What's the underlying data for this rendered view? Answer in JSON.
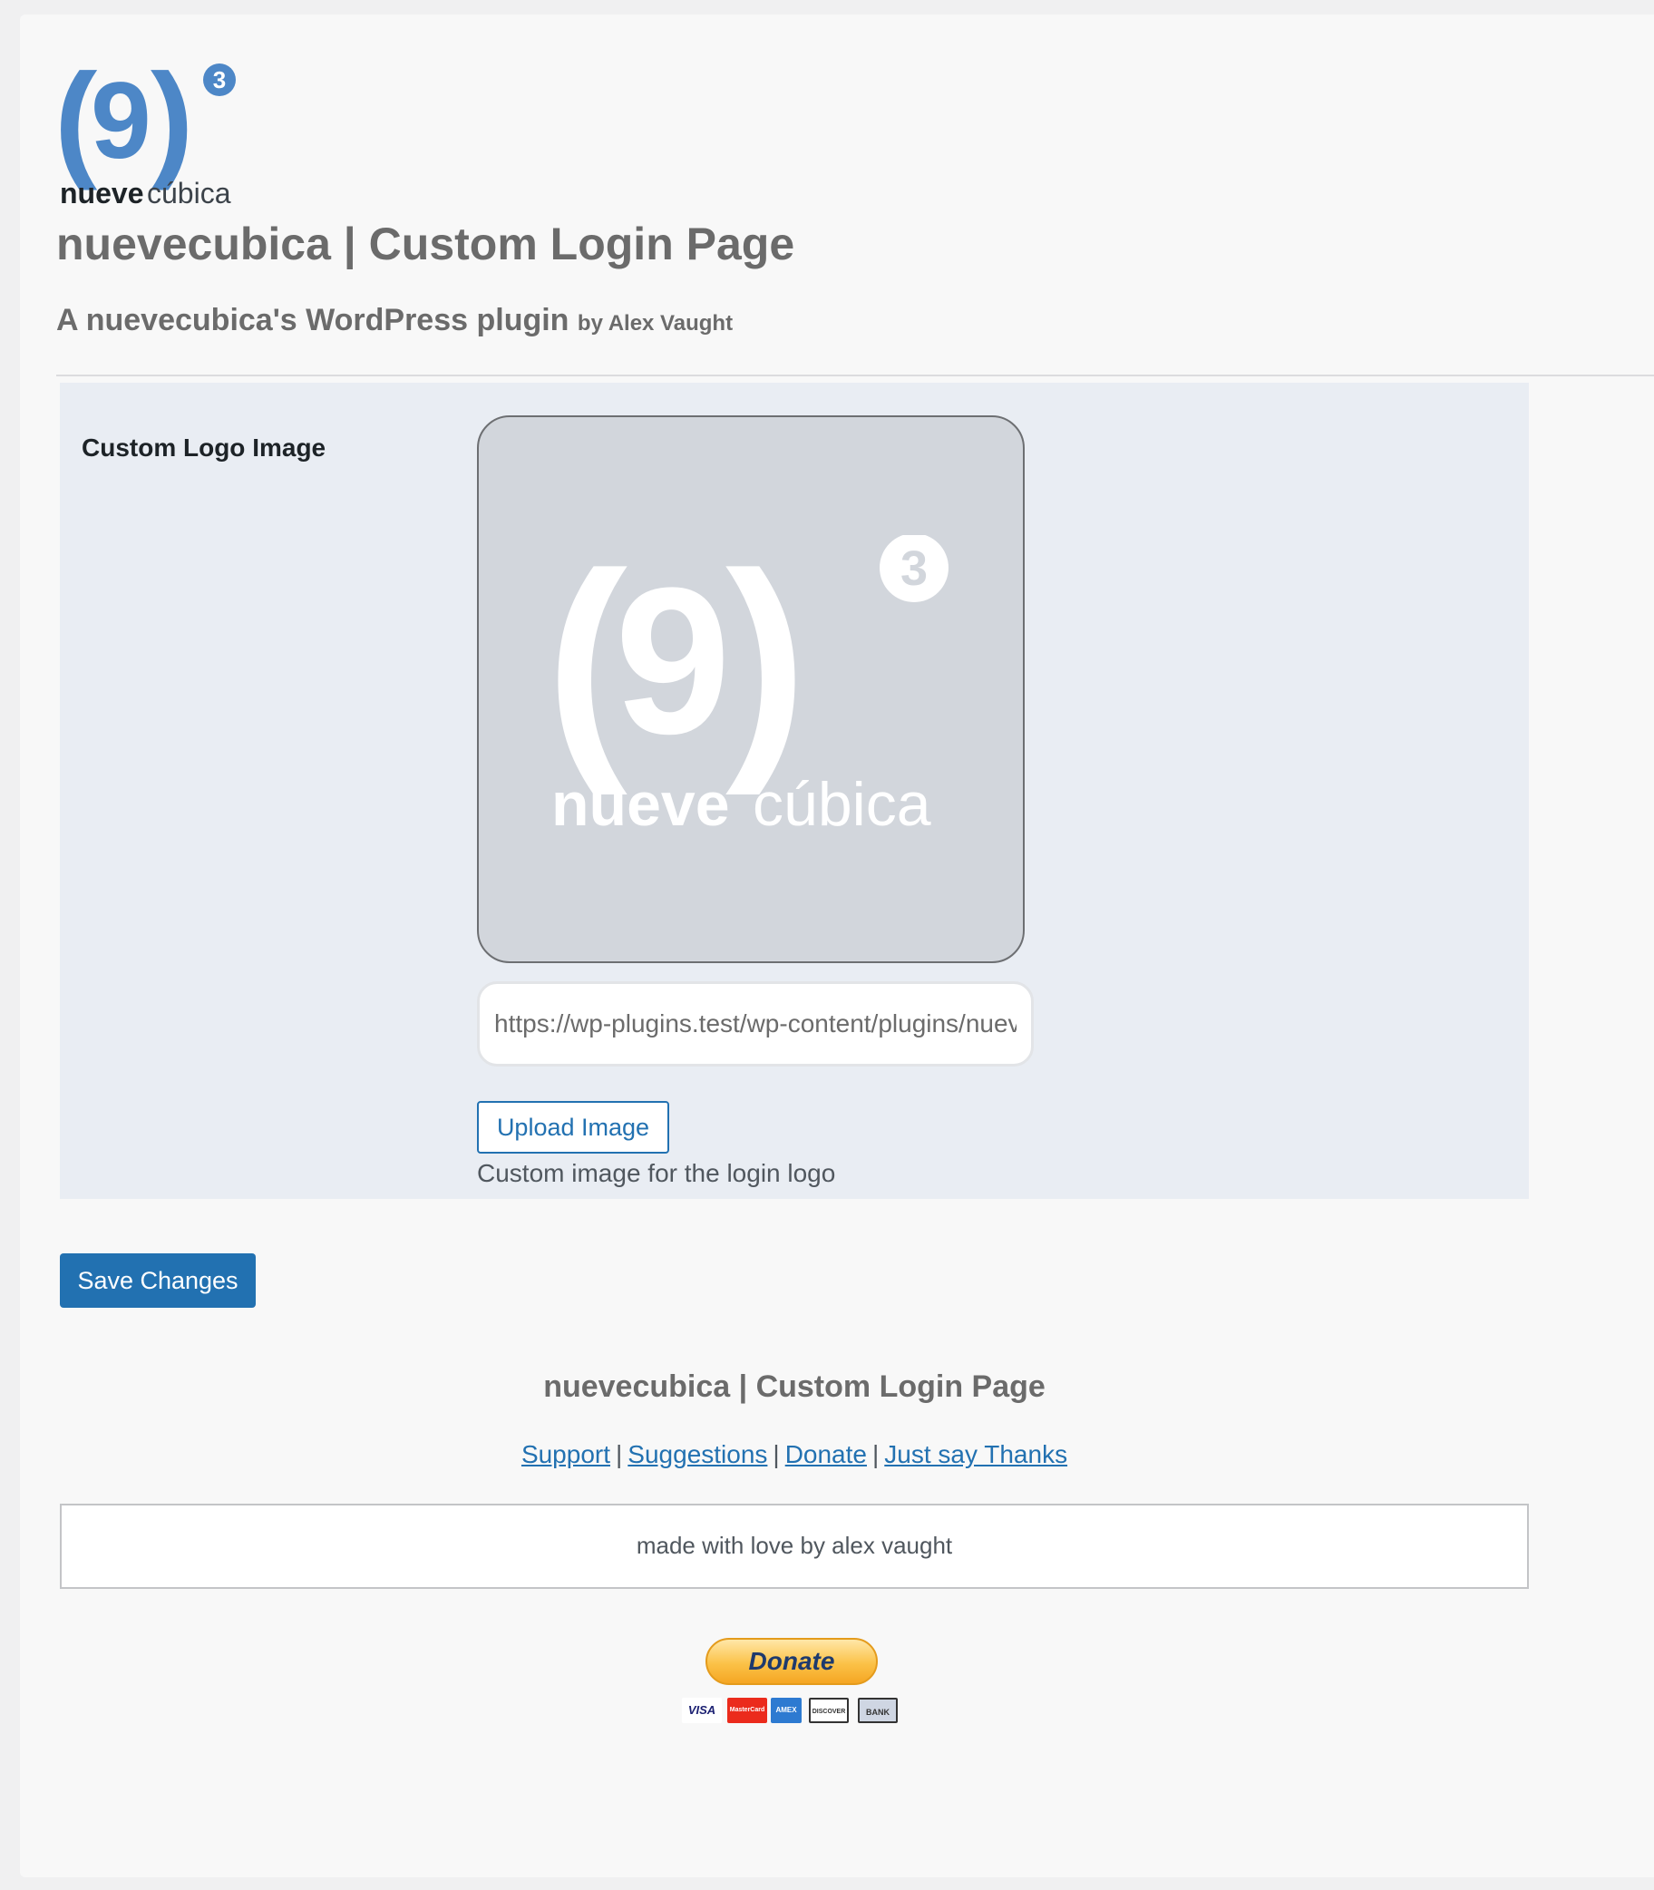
{
  "header": {
    "logo_word1": "nueve",
    "logo_word2": "cúbica",
    "logo_nine": "9",
    "logo_cube": "3",
    "title": "nuevecubica | Custom Login Page",
    "subtitle": "A nuevecubica's WordPress plugin",
    "subtitle_by": "by Alex Vaught"
  },
  "settings": {
    "logo_field": {
      "label": "Custom Logo Image",
      "url_value": "https://wp-plugins.test/wp-content/plugins/nuevecubica-custom-login-page/images/logo.png",
      "upload_label": "Upload Image",
      "description": "Custom image for the login logo"
    }
  },
  "actions": {
    "save_label": "Save Changes"
  },
  "footer": {
    "title": "nuevecubica | Custom Login Page",
    "links": [
      "Support",
      "Suggestions",
      "Donate",
      "Just say Thanks"
    ],
    "separator": "|",
    "love_text": "made with love by alex vaught",
    "donate_label": "Donate",
    "cards": [
      "VISA",
      "MasterCard",
      "AMEX",
      "DISCOVER",
      "BANK"
    ]
  },
  "colors": {
    "brand_blue": "#4d87c7",
    "wp_blue": "#2271b1",
    "panel_bg": "#e9edf3",
    "preview_bg": "#d2d6dc"
  }
}
